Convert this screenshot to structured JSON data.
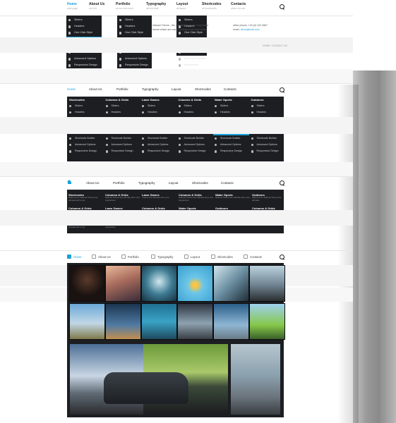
{
  "nav1": {
    "items": [
      {
        "label": "Home",
        "sub": "start page"
      },
      {
        "label": "About Us",
        "sub": "all a bit"
      },
      {
        "label": "Portfolio",
        "sub": "all our best work"
      },
      {
        "label": "Typography",
        "sub": "all font stuff"
      },
      {
        "label": "Layout",
        "sub": "all layout"
      },
      {
        "label": "Shortcodes",
        "sub": "all shortcodes"
      },
      {
        "label": "Contacts",
        "sub": "where we are"
      }
    ]
  },
  "dropdowns": [
    {
      "items": [
        "Sliders",
        "Headers",
        "One Click Style",
        "Vector Icons",
        "Layout Versions",
        "Shortcode Builder",
        "Advanced Options",
        "Responsive Design"
      ],
      "highlight": 3
    },
    {
      "items": [
        "Sliders",
        "Headers",
        "One Click Style",
        "Vector Icons",
        "Layout Versions",
        "Shortcode Builder",
        "Advanced Options",
        "Responsive Design"
      ],
      "highlight": -1
    },
    {
      "items": [
        "Sliders",
        "Headers",
        "One Click Style",
        "Vector Icons",
        "Layout Versions",
        "Shortcode Builder",
        "Advanced Options",
        "Responsive Design"
      ],
      "highlight": -1
    }
  ],
  "header": {
    "intro": "Natural Theme - the ultimate all in one responsive theme which are ready to bring in just few clicks",
    "phone_label": "office phone:",
    "phone": "+44 (0) 123 4567",
    "email_label": "email:",
    "email": "demo@mail.com"
  },
  "breadcrumb": "HOME / CONTACT US",
  "nav2": [
    "Home",
    "About Us",
    "Portfolio",
    "Typography",
    "Layout",
    "Shortcodes",
    "Contacts"
  ],
  "mega1": {
    "headers": [
      "Shortcodes",
      "Columns & Grids",
      "Lawn Games",
      "Columns & Grids",
      "Water Sports",
      "Outdoors"
    ],
    "items": [
      "Sliders",
      "Headers",
      "One Click Style",
      "Vector Icons",
      "Layout Versions",
      "Shortcode Builder",
      "Advanced Options",
      "Responsive Design"
    ],
    "highlight_col": 4,
    "highlight_row": 4
  },
  "nav3": [
    "About Us",
    "Portfolio",
    "Typography",
    "Layout",
    "Shortcodes",
    "Contacts"
  ],
  "mega2": {
    "groups": [
      {
        "h": "Shortcodes",
        "d": "Welcome to Natural Theme the ultimate all in one"
      },
      {
        "h": "Columns & Grids",
        "d": "Natural Theme the ultimate all in one responsive"
      },
      {
        "h": "Lawn Games",
        "d": "Theme the ultimate all in one"
      },
      {
        "h": "Columns & Grids",
        "d": "Natural Theme the ultimate all in one responsive"
      },
      {
        "h": "Water Sports",
        "d": "Natural Theme the ultimate all in one"
      },
      {
        "h": "Outdoors",
        "d": "Welcome to Natural Theme the ultimate"
      },
      {
        "h": "Columns & Grids",
        "d": "Natural Theme the ultimate all in one responsive"
      },
      {
        "h": "Lawn Games",
        "d": "Theme the ultimate all in one"
      },
      {
        "h": "Columns & Grids",
        "d": "Welcome to Natural Theme the ultimate all in one"
      },
      {
        "h": "Water Sports",
        "d": "responsive WordPress theme"
      },
      {
        "h": "Outdoors",
        "d": "Natural Theme the ultimate all in one responsive"
      },
      {
        "h": "Columns & Grids",
        "d": "Natural Theme the ultimate all in one responsive"
      },
      {
        "h": "Shortcodes",
        "d": "Welcome to Natural Theme the ultimate all in one"
      },
      {
        "h": "Columns & Grids",
        "d": "Natural Theme the ultimate all in one responsive"
      },
      {
        "h": "Lawn Games",
        "d": "Theme the ultimate all in one"
      }
    ]
  },
  "nav4": [
    "Home",
    "About Us",
    "Portfolio",
    "Typography",
    "Layout",
    "Shortcodes",
    "Contacts"
  ],
  "gallery": {
    "row1": [
      "dark-bird-photo",
      "city-sunset-photo",
      "chandelier-photo",
      "burger-photo",
      "smartphone-photo",
      "sports-car-photo"
    ],
    "row2": [
      "helicopter-photo",
      "runner-photo",
      "office-building-photo",
      "gun-photo",
      "jet-plane-photo",
      "green-car-photo"
    ],
    "big": [
      "family-snow-photo",
      "minivan-park-photo",
      "businessman-city-photo"
    ]
  },
  "colors": {
    "accent": "#1aa1d8",
    "menu_bg": "#1c1e22"
  }
}
